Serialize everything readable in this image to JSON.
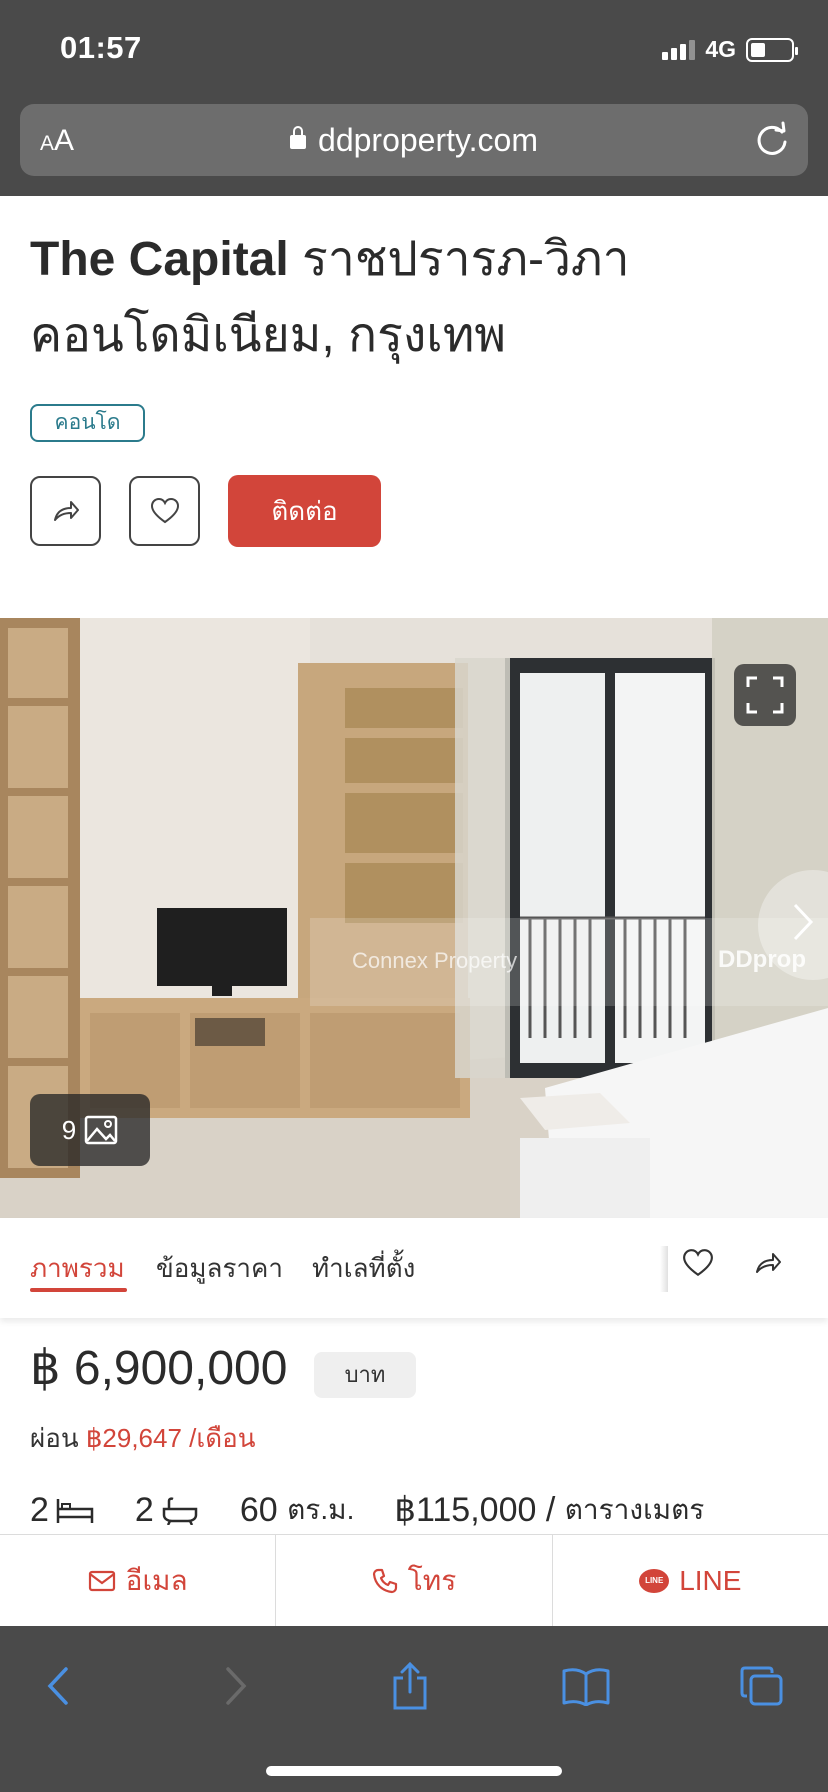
{
  "status_bar": {
    "time": "01:57",
    "network": "4G"
  },
  "browser": {
    "text_size_label": "AA",
    "url": "ddproperty.com"
  },
  "listing": {
    "title_en": "The Capital",
    "title_th": "ราชปรารภ-วิภา",
    "subtitle": "คอนโดมิเนียม, กรุงเทพ",
    "type_badge": "คอนโด",
    "contact_label": "ติดต่อ"
  },
  "gallery": {
    "photo_count": "9",
    "watermark_agent": "Connex Property",
    "watermark_logo": "DDprop"
  },
  "tabs": [
    {
      "label": "ภาพรวม",
      "active": true
    },
    {
      "label": "ข้อมูลราคา",
      "active": false
    },
    {
      "label": "ทำเลที่ตั้ง",
      "active": false
    }
  ],
  "price": {
    "amount": "฿ 6,900,000",
    "unit": "บาท",
    "installment_prefix": "ผ่อน",
    "installment_value": "฿29,647 /เดือน"
  },
  "specs": {
    "bedrooms": "2",
    "bathrooms": "2",
    "area": "60",
    "area_unit": "ตร.ม.",
    "price_per_sqm": "฿115,000 /",
    "price_per_sqm_unit": "ตารางเมตร"
  },
  "actions": {
    "email": "อีเมล",
    "call": "โทร",
    "line": "LINE"
  },
  "colors": {
    "accent": "#d2453a",
    "badge": "#2b7b8c",
    "chrome": "#4a4a4a",
    "toolbar_icon": "#4a90e2"
  }
}
